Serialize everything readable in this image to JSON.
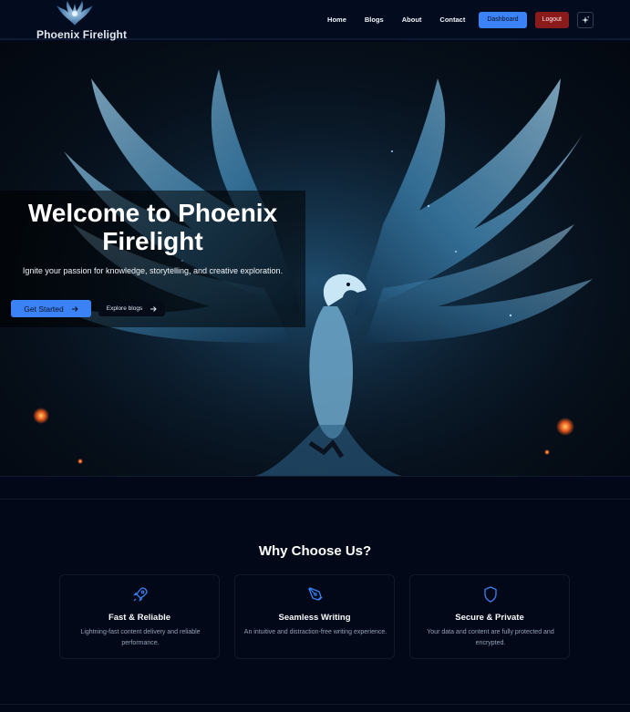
{
  "brand": {
    "name": "Phoenix Firelight"
  },
  "nav": {
    "links": [
      "Home",
      "Blogs",
      "About",
      "Contact"
    ],
    "dashboard_label": "Dashboard",
    "logout_label": "Logout"
  },
  "hero": {
    "title": "Welcome to Phoenix Firelight",
    "subtitle": "Ignite your passion for knowledge, storytelling, and creative exploration.",
    "primary_cta": "Get Started",
    "secondary_cta": "Explore blogs"
  },
  "features": {
    "title": "Why Choose Us?",
    "items": [
      {
        "icon": "rocket-icon",
        "title": "Fast & Reliable",
        "description": "Lightning-fast content delivery and reliable performance."
      },
      {
        "icon": "pen-nib-icon",
        "title": "Seamless Writing",
        "description": "An intuitive and distraction-free writing experience."
      },
      {
        "icon": "shield-icon",
        "title": "Secure & Private",
        "description": "Your data and content are fully protected and encrypted."
      }
    ]
  },
  "colors": {
    "accent": "#3b82f6",
    "danger": "#8b1b1b",
    "background": "#020817"
  }
}
